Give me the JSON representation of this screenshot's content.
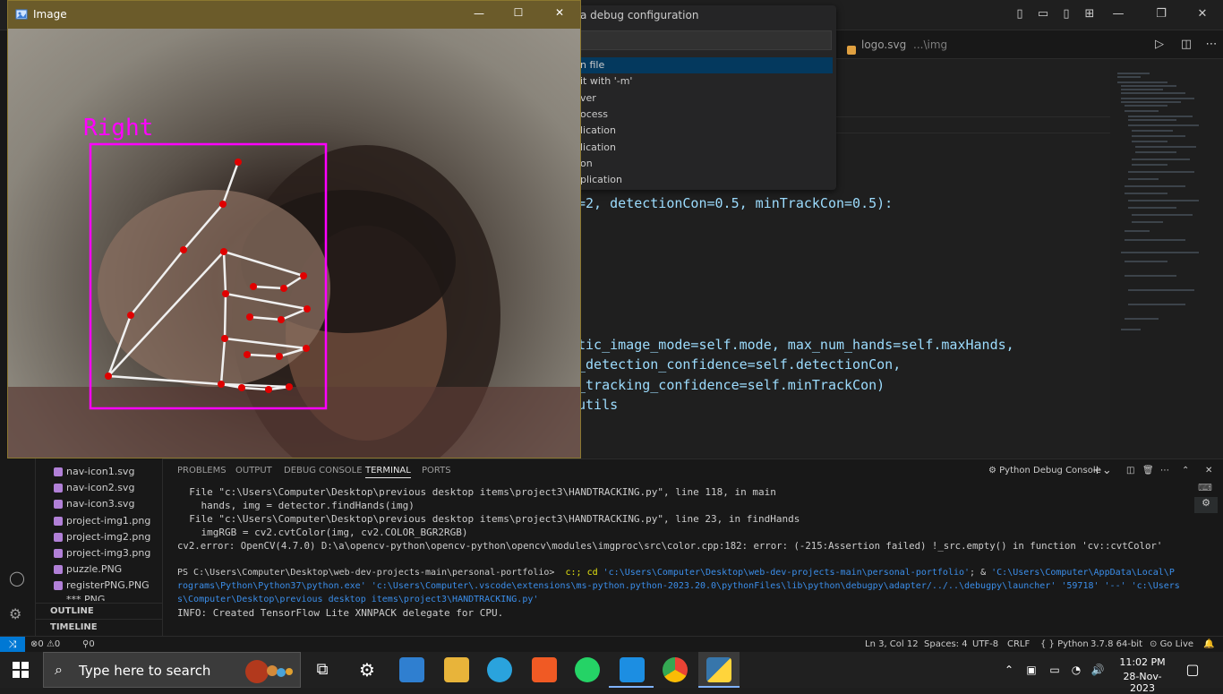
{
  "vscode": {
    "layout_controls": [
      "toggle-sidebar",
      "toggle-panel",
      "toggle-secondary-sidebar",
      "customize-layout"
    ],
    "window_controls": {
      "minimize": "—",
      "restore": "❐",
      "close": "✕"
    }
  },
  "quick_pick": {
    "title": "a debug configuration",
    "items": [
      "n file",
      "it with '-m'",
      "ver",
      "ocess",
      "lication",
      "lication",
      "on",
      "plication"
    ]
  },
  "editor_tab": {
    "name": "logo.svg",
    "path": "...\\img"
  },
  "code_lines": [
    "=2, detectionCon=0.5, minTrackCon=0.5):",
    "tic_image_mode=self.mode, max_num_hands=self.maxHands,",
    "_detection_confidence=self.detectionCon,",
    "_tracking_confidence=self.minTrackCon)",
    "utils"
  ],
  "image_window": {
    "title": "Image",
    "label": "Right",
    "controls": {
      "minimize": "—",
      "maximize": "☐",
      "close": "✕"
    }
  },
  "explorer": {
    "files": [
      "nav-icon1.svg",
      "nav-icon2.svg",
      "nav-icon3.svg",
      "project-img1.png",
      "project-img2.png",
      "project-img3.png",
      "puzzle.PNG",
      "registerPNG.PNG",
      "*** PNG"
    ],
    "sections": [
      "OUTLINE",
      "TIMELINE"
    ]
  },
  "panel": {
    "tabs": [
      "PROBLEMS",
      "OUTPUT",
      "DEBUG CONSOLE",
      "TERMINAL",
      "PORTS"
    ],
    "active_tab": "TERMINAL",
    "console_name": "Python Debug Console",
    "terminal": [
      "  File \"c:\\Users\\Computer\\Desktop\\previous desktop items\\project3\\HANDTRACKING.py\", line 118, in main",
      "    hands, img = detector.findHands(img)",
      "  File \"c:\\Users\\Computer\\Desktop\\previous desktop items\\project3\\HANDTRACKING.py\", line 23, in findHands",
      "    imgRGB = cv2.cvtColor(img, cv2.COLOR_BGR2RGB)",
      "cv2.error: OpenCV(4.7.0) D:\\a\\opencv-python\\opencv-python\\opencv\\modules\\imgproc\\src\\color.cpp:182: error: (-215:Assertion failed) !_src.empty() in function 'cv::cvtColor'",
      ""
    ],
    "prompt": "PS C:\\Users\\Computer\\Desktop\\web-dev-projects-main\\personal-portfolio> ",
    "cmd1": " c:; ",
    "cmd2": "cd ",
    "path1": "'c:\\Users\\Computer\\Desktop\\web-dev-projects-main\\personal-portfolio'",
    "amp": "; & ",
    "path2": "'C:\\Users\\Computer\\AppData\\Local\\P",
    "wrap1": "rograms\\Python\\Python37\\python.exe' 'c:\\Users\\Computer\\.vscode\\extensions\\ms-python.python-2023.20.0\\pythonFiles\\lib\\python\\debugpy\\adapter/../..\\debugpy\\launcher' '59718' '--' 'c:\\Users",
    "wrap2": "s\\Computer\\Desktop\\previous desktop items\\project3\\HANDTRACKING.py'",
    "info": "INFO: Created TensorFlow Lite XNNPACK delegate for CPU."
  },
  "statusbar": {
    "errors": "0",
    "warnings": "0",
    "ports": "0",
    "position": "Ln 3, Col 12",
    "spaces": "Spaces: 4",
    "encoding": "UTF-8",
    "eol": "CRLF",
    "language": "Python",
    "interpreter": "3.7.8 64-bit",
    "golive": "Go Live"
  },
  "taskbar": {
    "search_placeholder": "Type here to search",
    "time": "11:02 PM",
    "date": "28-Nov-2023"
  },
  "colors": {
    "accent": "#0078d4",
    "magenta": "#ff00ff",
    "landmark": "#e00000"
  }
}
